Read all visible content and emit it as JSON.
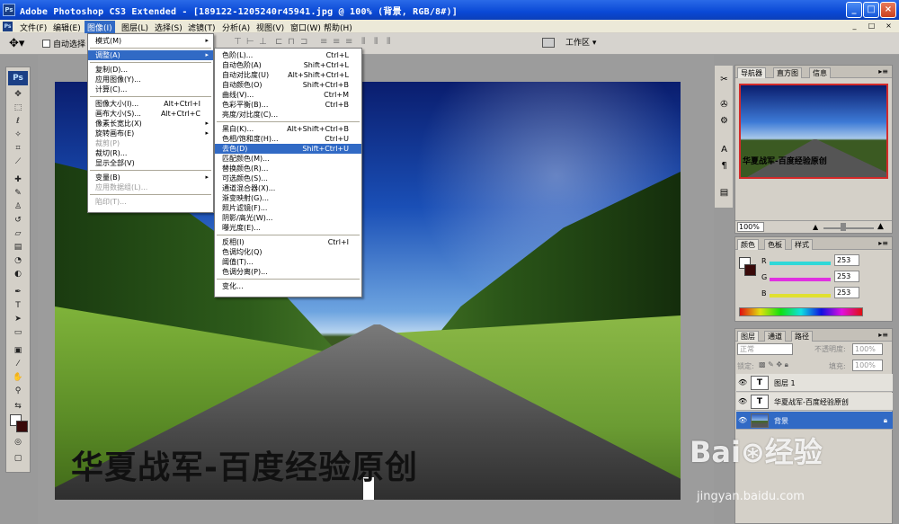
{
  "window": {
    "title": "Adobe Photoshop CS3 Extended - [189122-1205240r45941.jpg @ 100% (背景, RGB/8#)]",
    "controls": [
      "_",
      "□",
      "×"
    ]
  },
  "menubar": {
    "items": [
      "文件(F)",
      "编辑(E)",
      "图像(I)",
      "图层(L)",
      "选择(S)",
      "滤镜(T)",
      "分析(A)",
      "视图(V)",
      "窗口(W)",
      "帮助(H)"
    ],
    "active_index": 2,
    "doc_controls": [
      "_",
      "□",
      "×"
    ]
  },
  "optionsbar": {
    "auto_select_label": "自动选择",
    "workspace_label": "工作区 ▾"
  },
  "image_menu": {
    "items": [
      {
        "label": "模式(M)",
        "arrow": "▸"
      },
      {
        "sep": true
      },
      {
        "label": "调整(A)",
        "arrow": "▸",
        "hl": true
      },
      {
        "sep": true
      },
      {
        "label": "复制(D)..."
      },
      {
        "label": "应用图像(Y)..."
      },
      {
        "label": "计算(C)..."
      },
      {
        "sep": true
      },
      {
        "label": "图像大小(I)...",
        "shortcut": "Alt+Ctrl+I"
      },
      {
        "label": "画布大小(S)...",
        "shortcut": "Alt+Ctrl+C"
      },
      {
        "label": "像素长宽比(X)",
        "arrow": "▸"
      },
      {
        "label": "旋转画布(E)",
        "arrow": "▸"
      },
      {
        "label": "裁剪(P)",
        "disabled": true
      },
      {
        "label": "裁切(R)..."
      },
      {
        "label": "显示全部(V)"
      },
      {
        "sep": true
      },
      {
        "label": "变量(B)",
        "arrow": "▸"
      },
      {
        "label": "应用数据组(L)...",
        "disabled": true
      },
      {
        "sep": true
      },
      {
        "label": "陷印(T)...",
        "disabled": true
      }
    ]
  },
  "adjust_menu": {
    "items": [
      {
        "label": "色阶(L)...",
        "shortcut": "Ctrl+L"
      },
      {
        "label": "自动色阶(A)",
        "shortcut": "Shift+Ctrl+L"
      },
      {
        "label": "自动对比度(U)",
        "shortcut": "Alt+Shift+Ctrl+L"
      },
      {
        "label": "自动颜色(O)",
        "shortcut": "Shift+Ctrl+B"
      },
      {
        "label": "曲线(V)...",
        "shortcut": "Ctrl+M"
      },
      {
        "label": "色彩平衡(B)...",
        "shortcut": "Ctrl+B"
      },
      {
        "label": "亮度/对比度(C)..."
      },
      {
        "sep": true
      },
      {
        "label": "黑白(K)...",
        "shortcut": "Alt+Shift+Ctrl+B"
      },
      {
        "label": "色相/饱和度(H)...",
        "shortcut": "Ctrl+U"
      },
      {
        "label": "去色(D)",
        "shortcut": "Shift+Ctrl+U",
        "hl": true
      },
      {
        "label": "匹配颜色(M)..."
      },
      {
        "label": "替换颜色(R)..."
      },
      {
        "label": "可选颜色(S)..."
      },
      {
        "label": "通道混合器(X)..."
      },
      {
        "label": "渐变映射(G)..."
      },
      {
        "label": "照片滤镜(F)..."
      },
      {
        "label": "阴影/高光(W)..."
      },
      {
        "label": "曝光度(E)..."
      },
      {
        "sep": true
      },
      {
        "label": "反相(I)",
        "shortcut": "Ctrl+I"
      },
      {
        "label": "色调均化(Q)"
      },
      {
        "label": "阈值(T)..."
      },
      {
        "label": "色调分离(P)..."
      },
      {
        "sep": true
      },
      {
        "label": "变化..."
      }
    ]
  },
  "canvas": {
    "watermark_text": "华夏战军-百度经验原创"
  },
  "navigator_panel": {
    "tabs": [
      "导航器",
      "直方图",
      "信息"
    ],
    "zoom": "100%",
    "thumb_text": "华夏战军-百度经验原创"
  },
  "color_panel": {
    "tabs": [
      "颜色",
      "色板",
      "样式"
    ],
    "channels": [
      {
        "label": "R",
        "value": "253",
        "color": "#30d8d8"
      },
      {
        "label": "G",
        "value": "253",
        "color": "#e030e0"
      },
      {
        "label": "B",
        "value": "253",
        "color": "#e0e030"
      }
    ]
  },
  "layers_panel": {
    "tabs": [
      "图层",
      "通道",
      "路径"
    ],
    "blend_mode": "正常",
    "opacity_label": "不透明度:",
    "opacity_value": "100%",
    "lock_label": "锁定:",
    "fill_label": "填充:",
    "fill_value": "100%",
    "layers": [
      {
        "name": "图层 1",
        "type": "T"
      },
      {
        "name": "华夏战军-百度经验原创",
        "type": "T"
      },
      {
        "name": "背景",
        "type": "image",
        "selected": true
      }
    ]
  },
  "baidu_watermark": {
    "logo": "Bai⊛经验",
    "url": "jingyan.baidu.com"
  },
  "colors": {
    "menu_highlight": "#316ac5",
    "title_bar": "#0a49d6"
  }
}
